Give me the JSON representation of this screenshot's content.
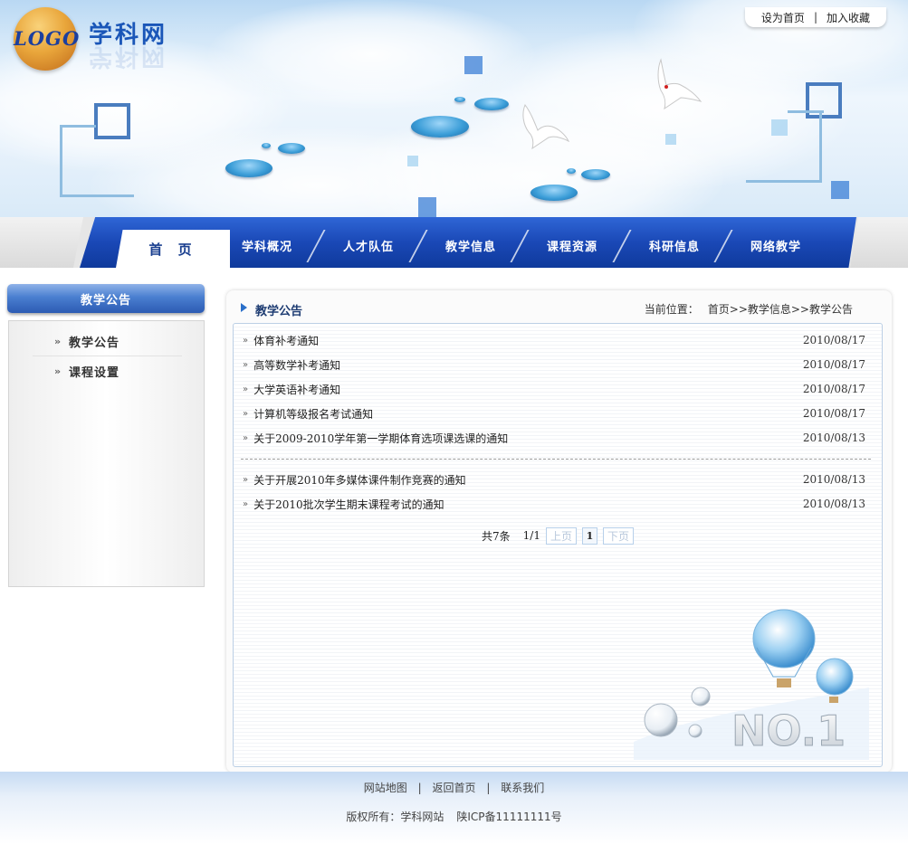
{
  "header": {
    "logo_text": "LOGO",
    "site_title": "学科网",
    "top_links": [
      "设为首页",
      "加入收藏"
    ],
    "top_link_separator": "|"
  },
  "nav": {
    "home": "首 页",
    "items": [
      "学科概况",
      "人才队伍",
      "教学信息",
      "课程资源",
      "科研信息",
      "网络教学"
    ]
  },
  "sidebar": {
    "title": "教学公告",
    "items": [
      "教学公告",
      "课程设置"
    ],
    "arrow": "»"
  },
  "main": {
    "title": "教学公告",
    "breadcrumb_label": "当前位置：",
    "breadcrumb_path": "首页>>教学信息>>教学公告",
    "row_arrow": "»",
    "notices": [
      {
        "title": "体育补考通知",
        "date": "2010/08/17"
      },
      {
        "title": "高等数学补考通知",
        "date": "2010/08/17"
      },
      {
        "title": "大学英语补考通知",
        "date": "2010/08/17"
      },
      {
        "title": "计算机等级报名考试通知",
        "date": "2010/08/17"
      },
      {
        "title": "关于2009-2010学年第一学期体育选项课选课的通知",
        "date": "2010/08/13"
      },
      {
        "title": "关于开展2010年多媒体课件制作竞赛的通知",
        "date": "2010/08/13"
      },
      {
        "title": "关于2010批次学生期末课程考试的通知",
        "date": "2010/08/13"
      }
    ],
    "pager": {
      "total": "共7条",
      "page_of": "1/1",
      "prev": "上页",
      "current": "1",
      "next": "下页"
    },
    "decoration_text": "NO.1"
  },
  "footer": {
    "links": [
      "网站地图",
      "返回首页",
      "联系我们"
    ],
    "link_separator": "|",
    "copyright": "版权所有：学科网站",
    "icp": "陕ICP备11111111号"
  },
  "colors": {
    "nav_blue": "#1a48b6",
    "title_blue": "#1a56b8",
    "accent": "#2a6fc9"
  }
}
